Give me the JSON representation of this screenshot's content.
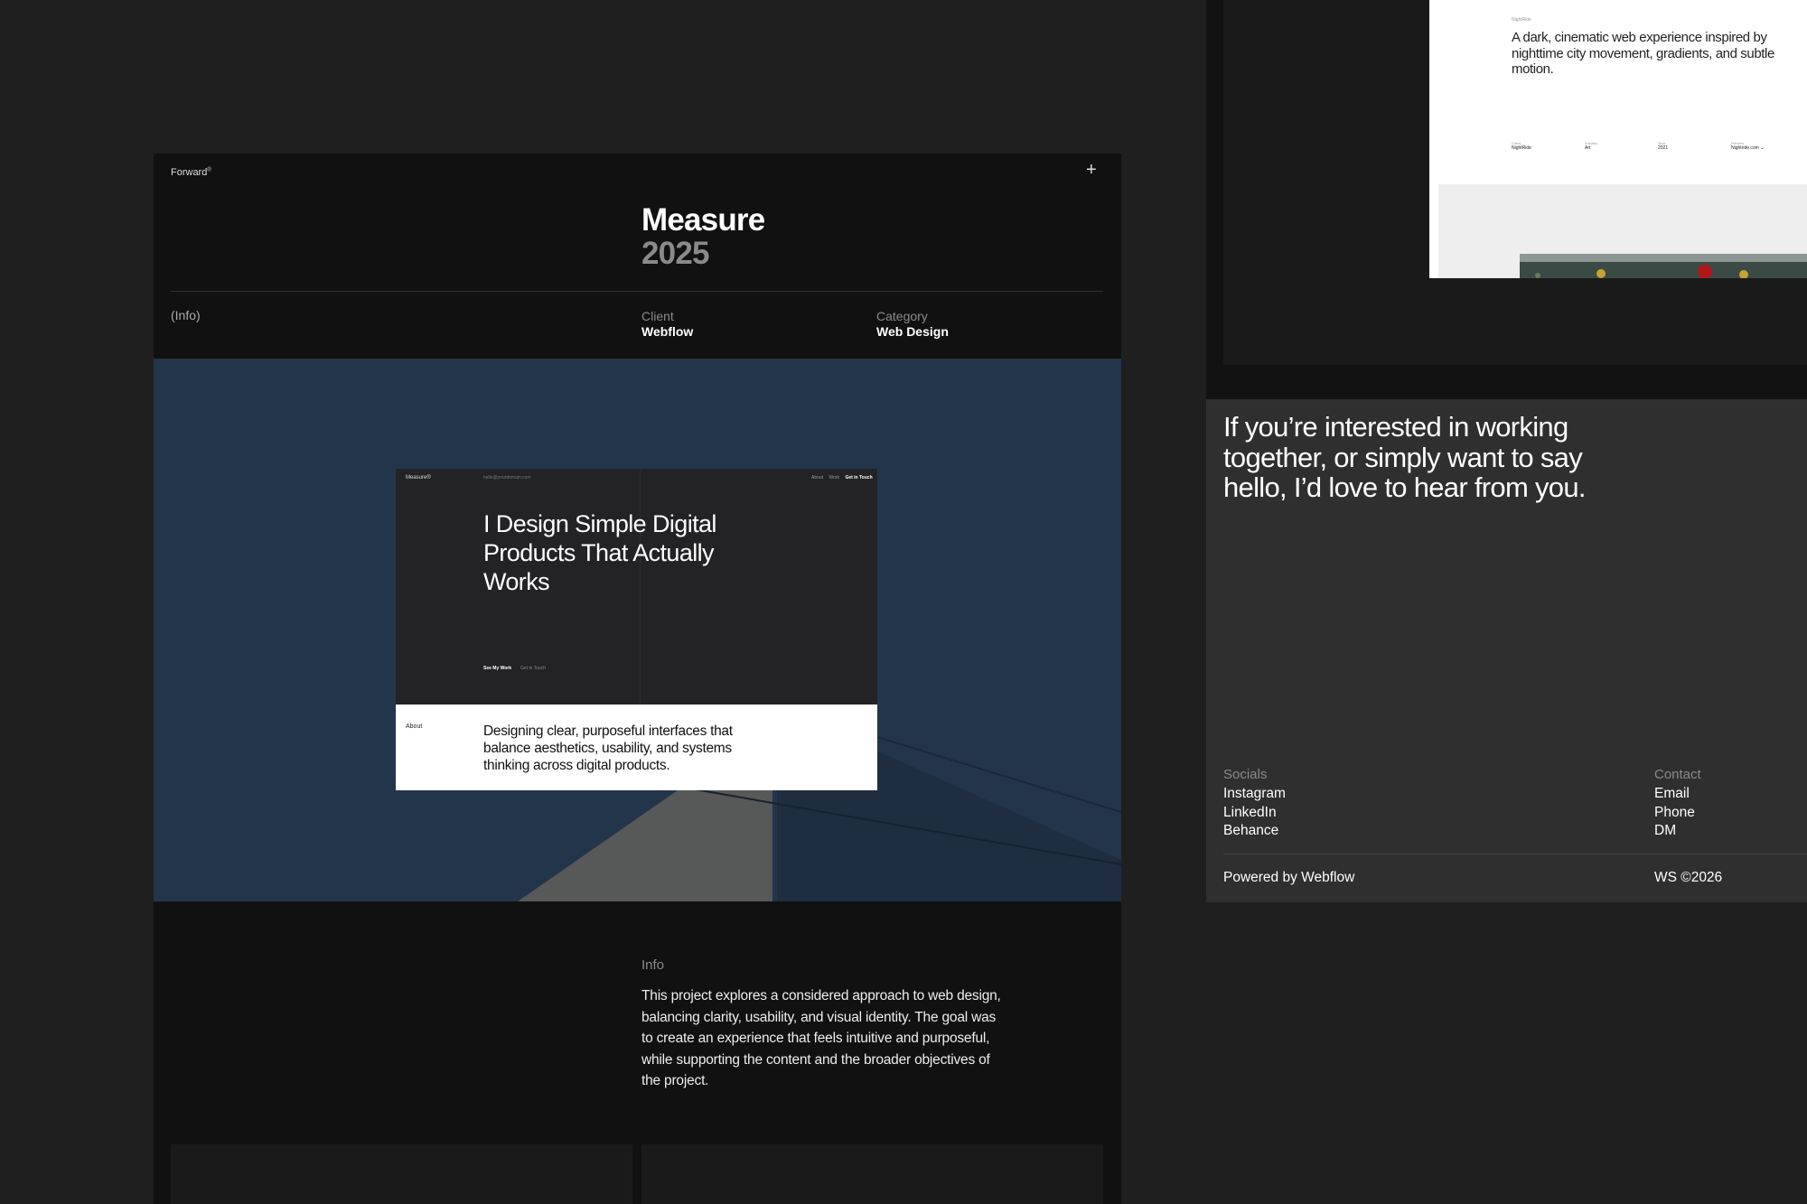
{
  "main": {
    "brand": "Forward",
    "brand_sup": "®",
    "plus_icon": "+",
    "project_title": "Measure",
    "project_year": "2025",
    "info_label": "(Info)",
    "client_label": "Client",
    "client_value": "Webflow",
    "category_label": "Category",
    "category_value": "Web Design",
    "info_title": "Info",
    "info_body": "This project explores a considered approach to web design, balancing clarity, usability, and visual identity. The goal was to create an experience that feels intuitive and purposeful, while supporting the content and the broader objectives of the project."
  },
  "mockup": {
    "brand": "Measure®",
    "email": "hello@yourdomain.com",
    "nav": [
      "About",
      "Work",
      "Get in Touch"
    ],
    "headline": "I Design Simple Digital Products That Actually Works",
    "cta_primary": "See My Work",
    "cta_secondary": "Get in Touch",
    "about_label": "About",
    "about_text": "Designing clear, purposeful interfaces that balance aesthetics, usability, and systems thinking across digital products."
  },
  "project_preview": {
    "name": "NightRide",
    "description": "A dark, cinematic web experience inspired by nighttime city movement, gradients, and subtle motion.",
    "meta": [
      {
        "label": "Client",
        "value": "NightRide"
      },
      {
        "label": "Industry",
        "value": "Art"
      },
      {
        "label": "Year",
        "value": "2021"
      },
      {
        "label": "Preview",
        "value": "Nightride.com"
      }
    ]
  },
  "contact": {
    "headline": "If you’re interested in working together, or simply want to say hello, I’d love to hear from you.",
    "socials_label": "Socials",
    "socials": [
      "Instagram",
      "LinkedIn",
      "Behance"
    ],
    "contact_label": "Contact",
    "contacts": [
      "Email",
      "Phone",
      "DM"
    ],
    "powered": "Powered by Webflow",
    "copyright": "WS ©2026"
  },
  "icons": {
    "plus": "plus-icon",
    "preview_arrow": "chevron-down-icon"
  }
}
